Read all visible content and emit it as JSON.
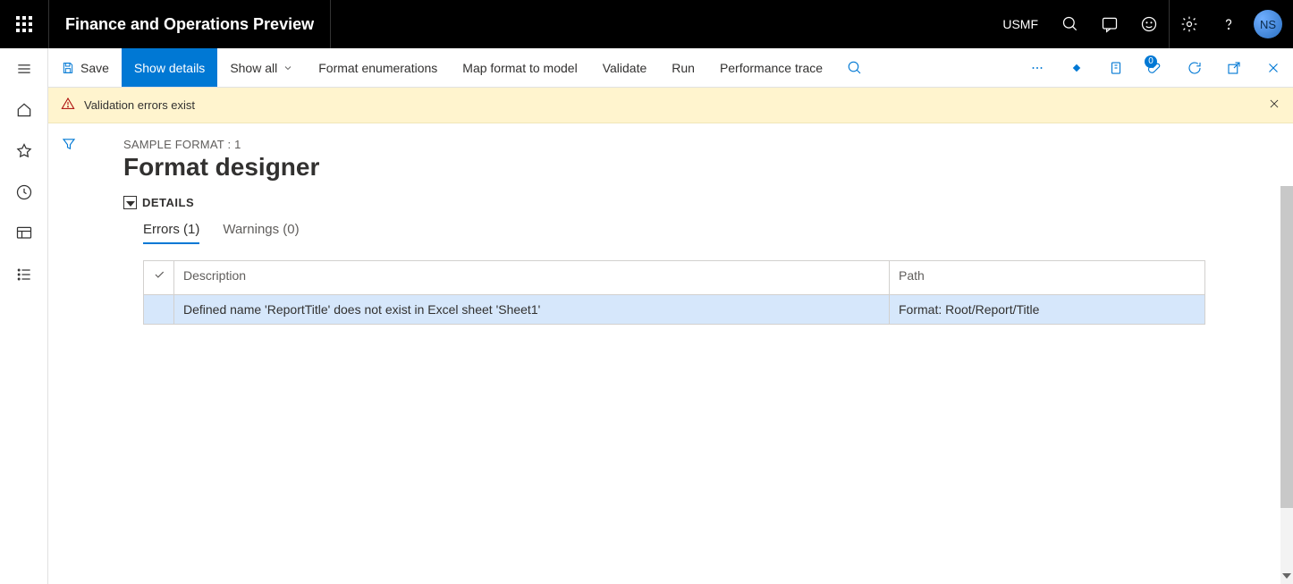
{
  "header": {
    "app_title": "Finance and Operations Preview",
    "company": "USMF",
    "avatar_initials": "NS"
  },
  "actionbar": {
    "save": "Save",
    "show_details": "Show details",
    "show_all": "Show all",
    "format_enumerations": "Format enumerations",
    "map_format": "Map format to model",
    "validate": "Validate",
    "run": "Run",
    "perf_trace": "Performance trace",
    "attachments_badge": "0"
  },
  "validation": {
    "message": "Validation errors exist"
  },
  "page": {
    "breadcrumb": "SAMPLE FORMAT : 1",
    "title": "Format designer",
    "details_label": "DETAILS"
  },
  "tabs": {
    "errors_label": "Errors (1)",
    "warnings_label": "Warnings (0)"
  },
  "table": {
    "headers": {
      "description": "Description",
      "path": "Path"
    },
    "rows": [
      {
        "description": "Defined name 'ReportTitle' does not exist in Excel sheet 'Sheet1'",
        "path": "Format: Root/Report/Title"
      }
    ]
  }
}
